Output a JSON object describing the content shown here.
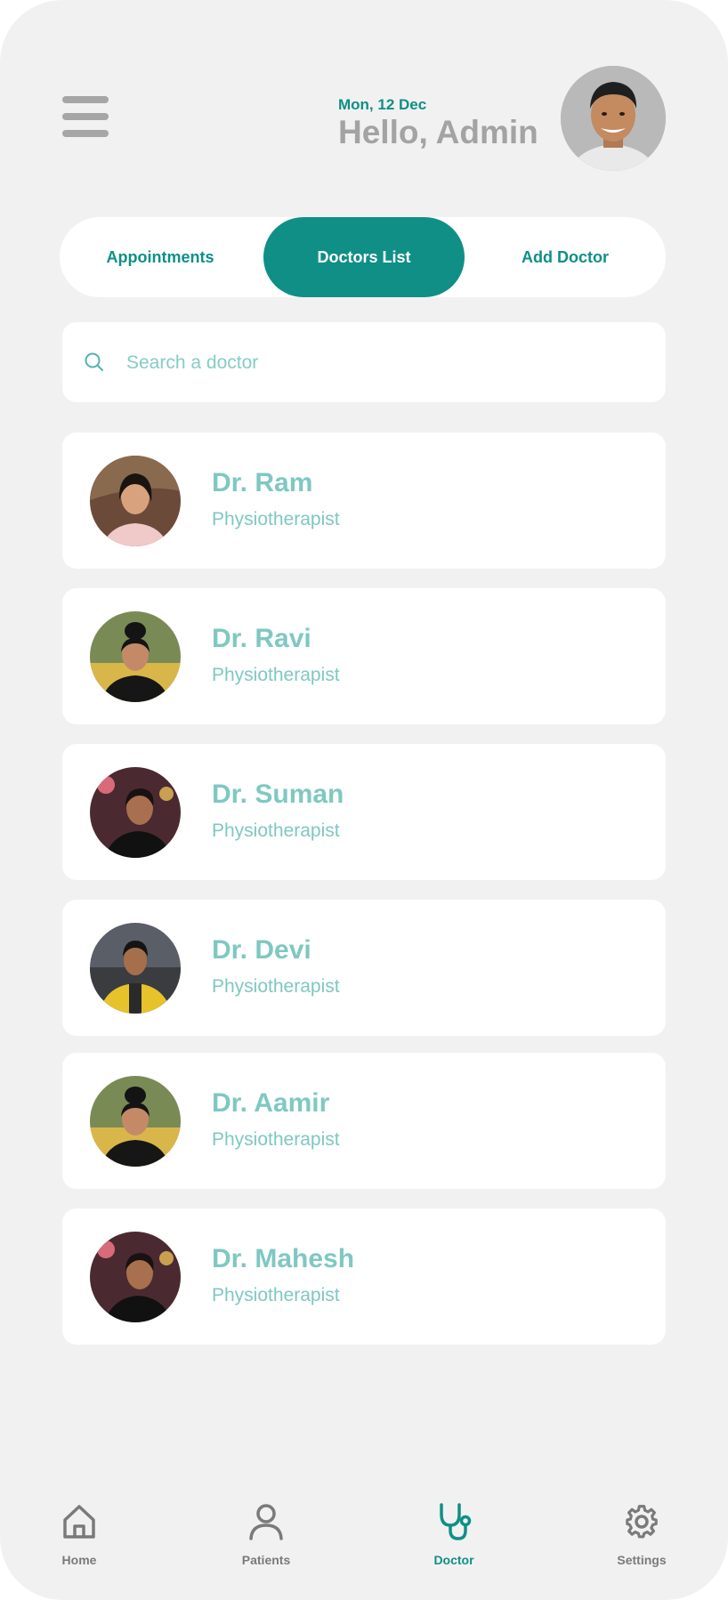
{
  "header": {
    "date": "Mon, 12 Dec",
    "greeting": "Hello, Admin"
  },
  "tabs": [
    {
      "label": "Appointments",
      "active": false
    },
    {
      "label": "Doctors List",
      "active": true
    },
    {
      "label": "Add Doctor",
      "active": false
    }
  ],
  "search": {
    "placeholder": "Search a doctor"
  },
  "doctors": [
    {
      "name": "Dr. Ram",
      "role": "Physiotherapist"
    },
    {
      "name": "Dr. Ravi",
      "role": "Physiotherapist"
    },
    {
      "name": "Dr. Suman",
      "role": "Physiotherapist"
    },
    {
      "name": "Dr. Devi",
      "role": "Physiotherapist"
    },
    {
      "name": "Dr. Aamir",
      "role": "Physiotherapist"
    },
    {
      "name": "Dr. Mahesh",
      "role": "Physiotherapist"
    }
  ],
  "bottom_nav": [
    {
      "label": "Home",
      "icon": "home-icon",
      "active": false
    },
    {
      "label": "Patients",
      "icon": "user-icon",
      "active": false
    },
    {
      "label": "Doctor",
      "icon": "stethoscope-icon",
      "active": true
    },
    {
      "label": "Settings",
      "icon": "gear-icon",
      "active": false
    }
  ],
  "colors": {
    "accent": "#0f8f86",
    "accent_light": "#7fc8c2",
    "background": "#f1f1f1",
    "muted_text": "#a3a3a3"
  }
}
